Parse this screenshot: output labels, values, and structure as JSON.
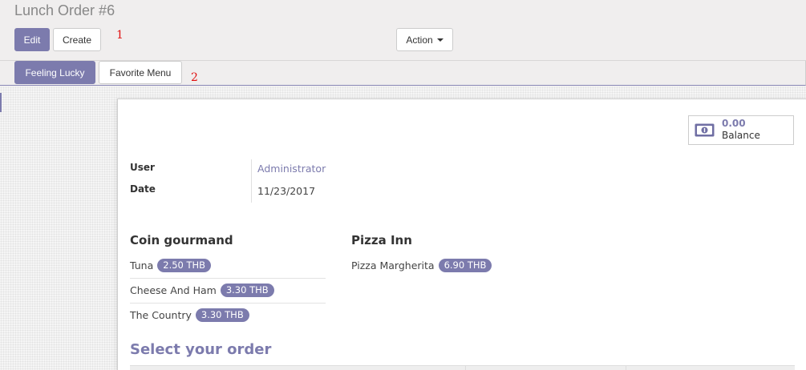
{
  "breadcrumb": {
    "title": "Lunch Order #6"
  },
  "toolbar": {
    "edit_label": "Edit",
    "create_label": "Create",
    "action_label": "Action",
    "annotation": "1"
  },
  "header": {
    "feeling_lucky_label": "Feeling Lucky",
    "favorite_menu_label": "Favorite Menu",
    "annotation": "2"
  },
  "balance": {
    "value": "0.00",
    "label": "Balance",
    "icon": "money-icon"
  },
  "fields": {
    "user_label": "User",
    "user_value": "Administrator",
    "date_label": "Date",
    "date_value": "11/23/2017"
  },
  "vendors": [
    {
      "name": "Coin gourmand",
      "products": [
        {
          "name": "Tuna",
          "price": "2.50 THB"
        },
        {
          "name": "Cheese And Ham",
          "price": "3.30 THB"
        },
        {
          "name": "The Country",
          "price": "3.30 THB"
        }
      ]
    },
    {
      "name": "Pizza Inn",
      "products": [
        {
          "name": "Pizza Margherita",
          "price": "6.90 THB"
        }
      ]
    }
  ],
  "order": {
    "title": "Select your order"
  },
  "colors": {
    "accent": "#7c7bad",
    "annotation": "#e01010"
  }
}
